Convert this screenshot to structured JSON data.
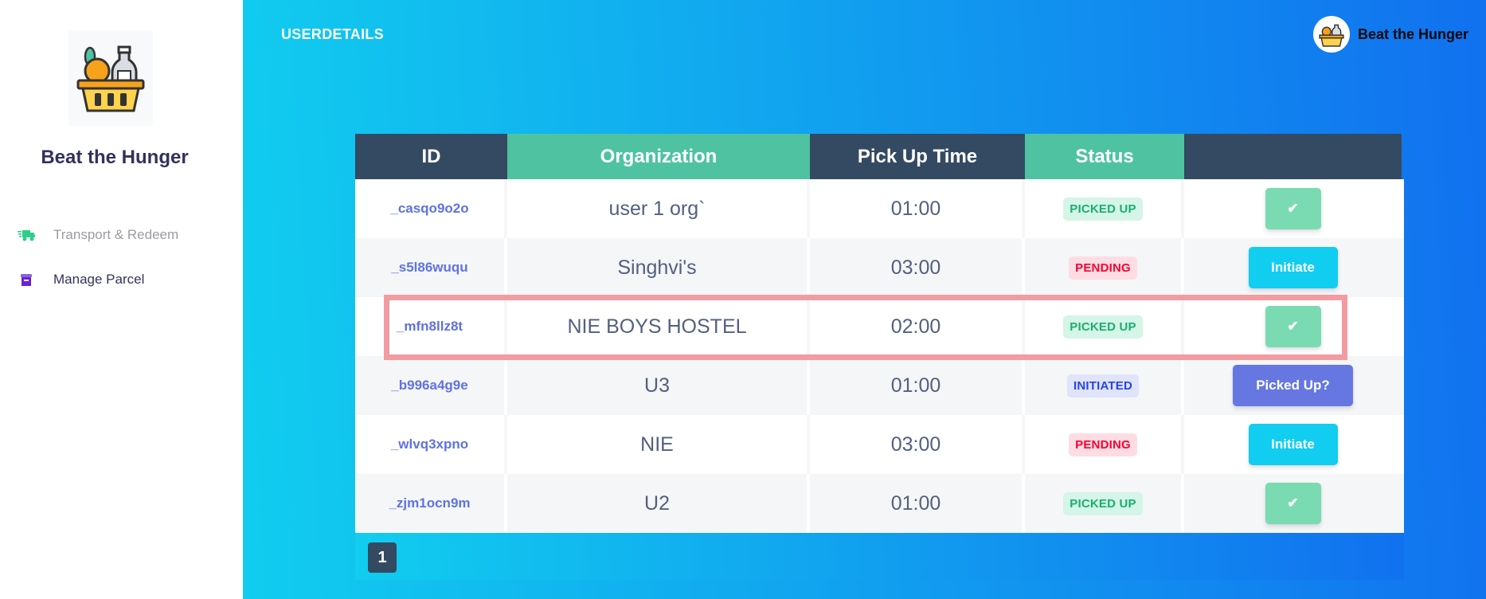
{
  "sidebar": {
    "brand": "Beat the Hunger",
    "items": [
      {
        "label": "Transport & Redeem",
        "icon": "truck-icon"
      },
      {
        "label": "Manage Parcel",
        "icon": "parcel-icon"
      }
    ]
  },
  "header": {
    "title": "USERDETAILS",
    "user_name": "Beat the Hunger"
  },
  "table": {
    "columns": [
      "ID",
      "Organization",
      "Pick Up Time",
      "Status",
      ""
    ],
    "rows": [
      {
        "id": "_casqo9o2o",
        "org": "user 1 org`",
        "time": "01:00",
        "status": "PICKED UP",
        "action": "✔"
      },
      {
        "id": "_s5l86wuqu",
        "org": "Singhvi's",
        "time": "03:00",
        "status": "PENDING",
        "action": "Initiate"
      },
      {
        "id": "_mfn8llz8t",
        "org": "NIE BOYS HOSTEL",
        "time": "02:00",
        "status": "PICKED UP",
        "action": "✔"
      },
      {
        "id": "_b996a4g9e",
        "org": "U3",
        "time": "01:00",
        "status": "INITIATED",
        "action": "Picked Up?"
      },
      {
        "id": "_wlvq3xpno",
        "org": "NIE",
        "time": "03:00",
        "status": "PENDING",
        "action": "Initiate"
      },
      {
        "id": "_zjm1ocn9m",
        "org": "U2",
        "time": "01:00",
        "status": "PICKED UP",
        "action": "✔"
      }
    ]
  },
  "pagination": {
    "current": "1"
  },
  "colors": {
    "header_dark": "#344a62",
    "header_green": "#4fc3a1",
    "gradient_start": "#11cdef",
    "gradient_end": "#1171ef",
    "highlight": "#f29ba1"
  }
}
